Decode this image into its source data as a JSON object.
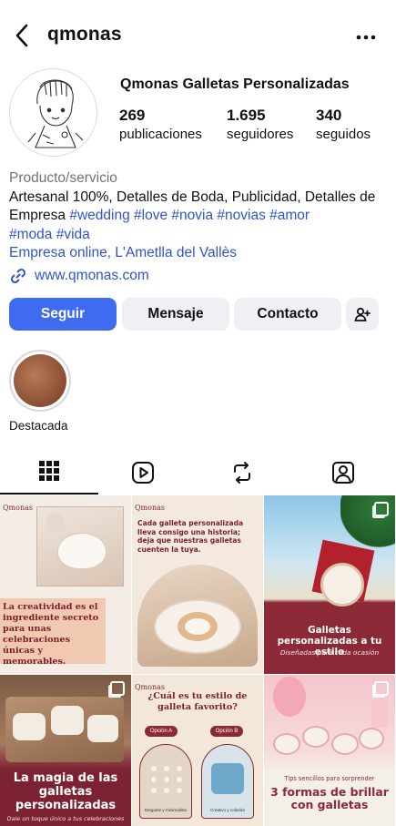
{
  "header": {
    "username": "qmonas"
  },
  "profile": {
    "display_name": "Qmonas Galletas Personalizadas",
    "posts_count": "269",
    "posts_label": "publicaciones",
    "followers_count": "1.695",
    "followers_label": "seguidores",
    "following_count": "340",
    "following_label": "seguidos"
  },
  "bio": {
    "category": "Producto/servicio",
    "text": "Artesanal 100%, Detalles de Boda, Publicidad, Detalles de Empresa",
    "hashtags": [
      "#wedding",
      "#love",
      "#novia",
      "#novias",
      "#amor",
      "#moda",
      "#vida"
    ],
    "location": "Empresa online, L'Ametlla del Vallès",
    "website": "www.qmonas.com"
  },
  "buttons": {
    "follow": "Seguir",
    "message": "Mensaje",
    "contact": "Contacto"
  },
  "highlights": [
    {
      "label": "Destacada"
    }
  ],
  "posts": [
    {
      "logo": "Qmonas",
      "caption": "La creatividad es el ingrediente secreto para unas celebraciones únicas y memorables."
    },
    {
      "logo": "Qmonas",
      "caption": "Cada galleta personalizada lleva consigo una historia; deja que nuestras galletas cuenten la tuya."
    },
    {
      "caption": "Galletas personalizadas a tu estilo",
      "subcaption": "Diseñadas para cada ocasión"
    },
    {
      "caption": "La magia de las galletas personalizadas",
      "subcaption": "Dale un toque único a tus celebraciones"
    },
    {
      "logo": "Qmonas",
      "caption": "¿Cuál es tu estilo de galleta favorito?",
      "option_a": "Opción A",
      "option_b": "Opción B",
      "label_a": "Elegante y minimalista",
      "label_b": "Creativo y colorido"
    },
    {
      "pre": "Tips sencillos para sorprender",
      "caption": "3 formas de brillar con galletas"
    }
  ],
  "colors": {
    "accent": "#3e6bf0",
    "link": "#2f55c9",
    "burgundy": "#8b2a36",
    "cream": "#f3e7da"
  }
}
